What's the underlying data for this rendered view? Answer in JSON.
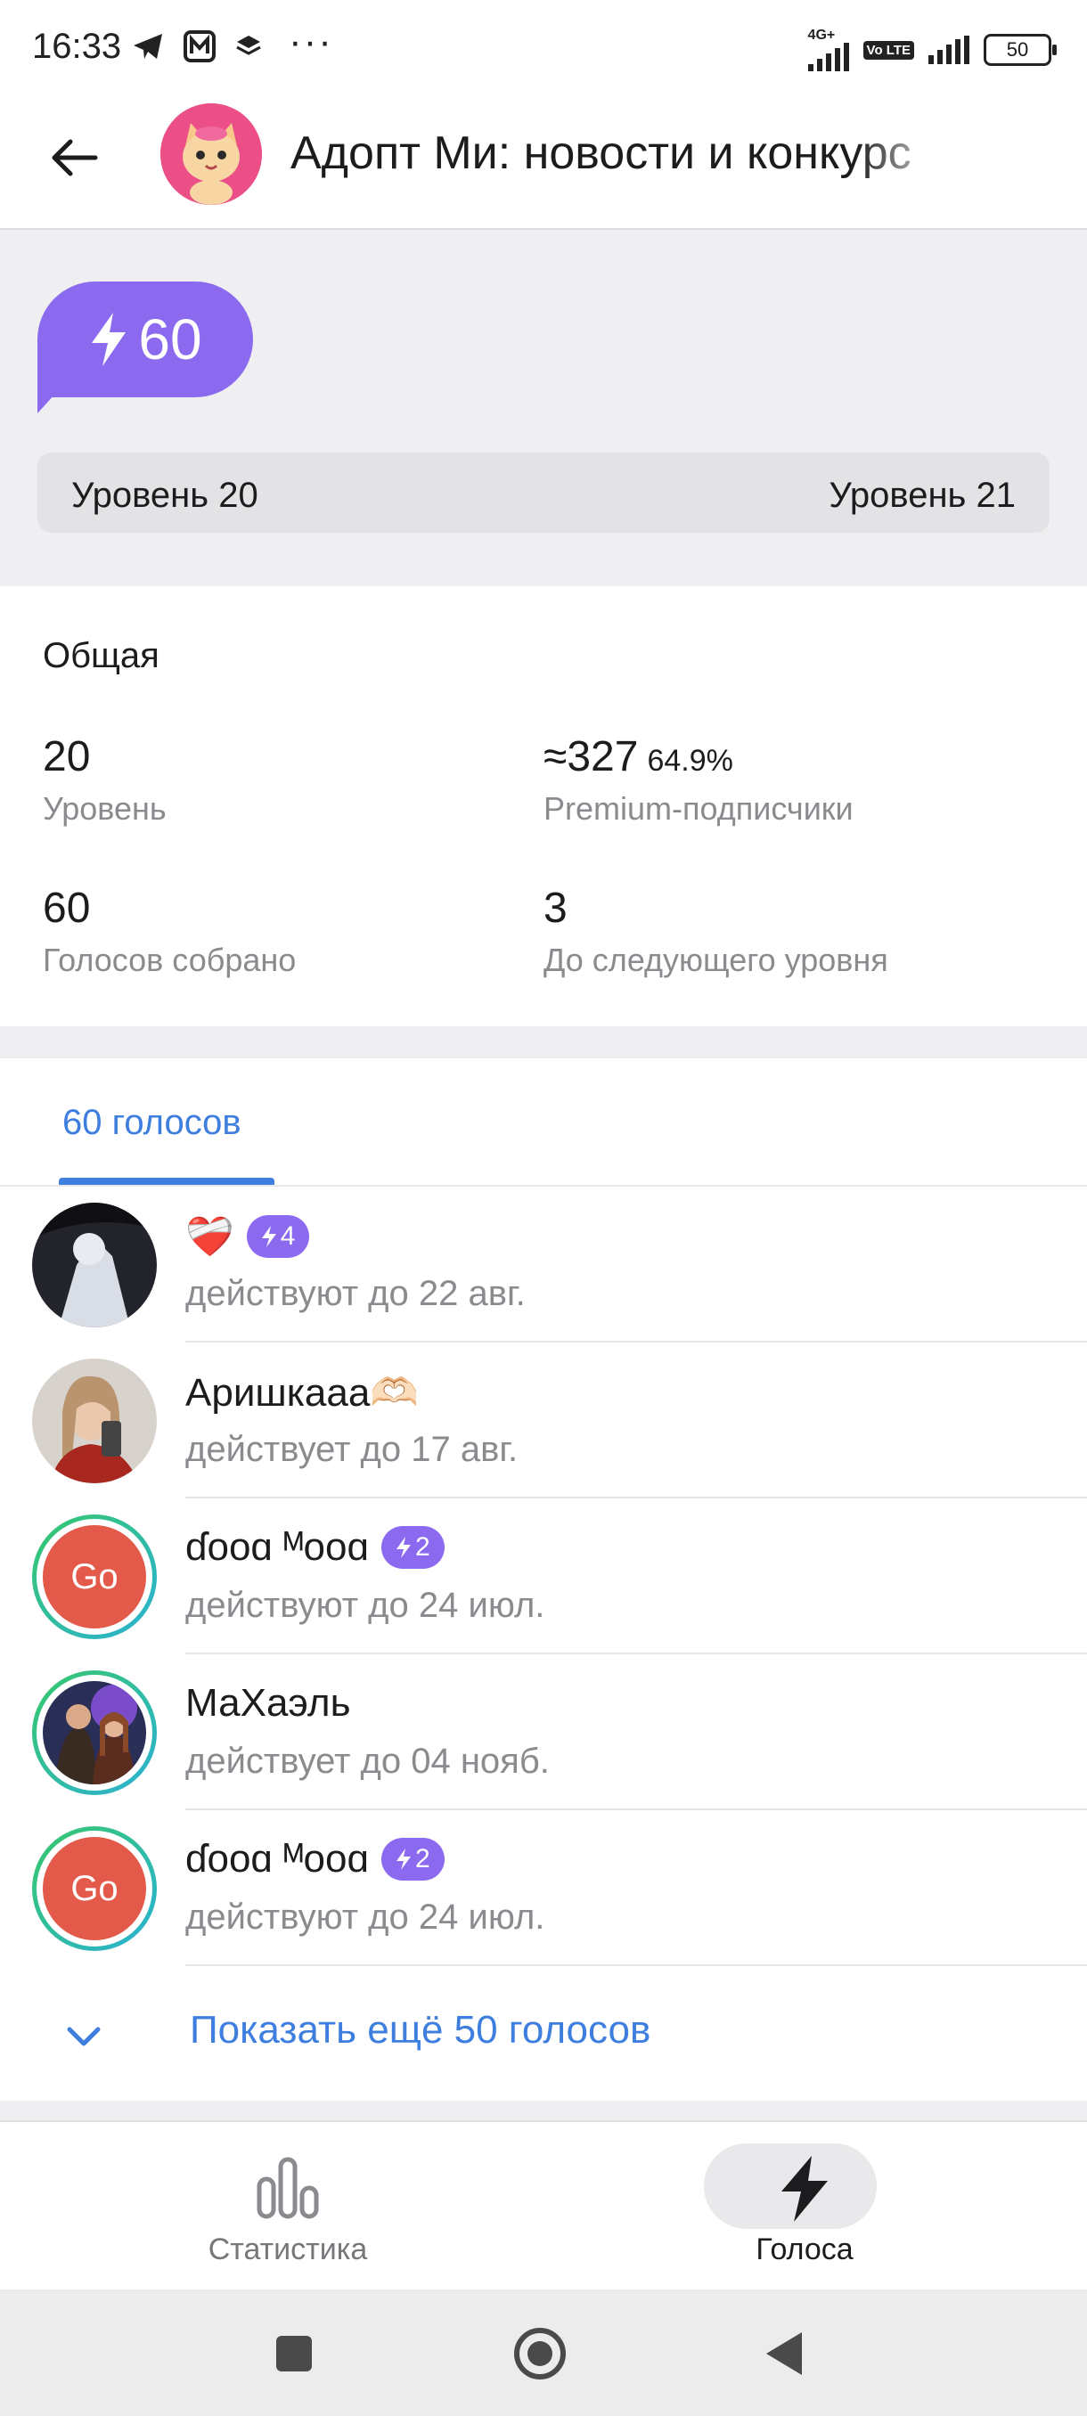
{
  "status_bar": {
    "time": "16:33",
    "dots": "···",
    "network_label": "4G+",
    "volte_label": "Vo LTE",
    "battery": "50"
  },
  "header": {
    "title": "Адопт Ми: новости и конкурс"
  },
  "boost": {
    "count": "60",
    "level_current": "Уровень 20",
    "level_next": "Уровень 21"
  },
  "stats": {
    "section_title": "Общая",
    "items": [
      {
        "value": "20",
        "label": "Уровень"
      },
      {
        "value": "≈327",
        "extra": "64.9%",
        "label": "Premium-подписчики"
      },
      {
        "value": "60",
        "label": "Голосов собрано"
      },
      {
        "value": "3",
        "label": "До следующего уровня"
      }
    ]
  },
  "voters": {
    "tab_label": "60 голосов",
    "rows": [
      {
        "name": "❤️‍🩹",
        "chip": "4",
        "sub": "действуют до 22 авг.",
        "avatar": "dark-photo"
      },
      {
        "name": "Аришкааа🫶🏻",
        "chip": "",
        "sub": "действует до 17 авг.",
        "avatar": "light-photo"
      },
      {
        "name": "ɗooɑ ᴹooɑ",
        "chip": "2",
        "sub": "действуют до 24 июл.",
        "avatar": "Go"
      },
      {
        "name": "МаХаэль",
        "chip": "",
        "sub": "действует до 04 нояб.",
        "avatar": "photo-ring"
      },
      {
        "name": "ɗooɑ ᴹooɑ",
        "chip": "2",
        "sub": "действуют до 24 июл.",
        "avatar": "Go"
      }
    ],
    "show_more": "Показать ещё 50 голосов"
  },
  "bottom_nav": {
    "stats_label": "Статистика",
    "votes_label": "Голоса"
  },
  "colors": {
    "accent_blue": "#3d7ede",
    "boost_purple": "#8b6af0"
  }
}
